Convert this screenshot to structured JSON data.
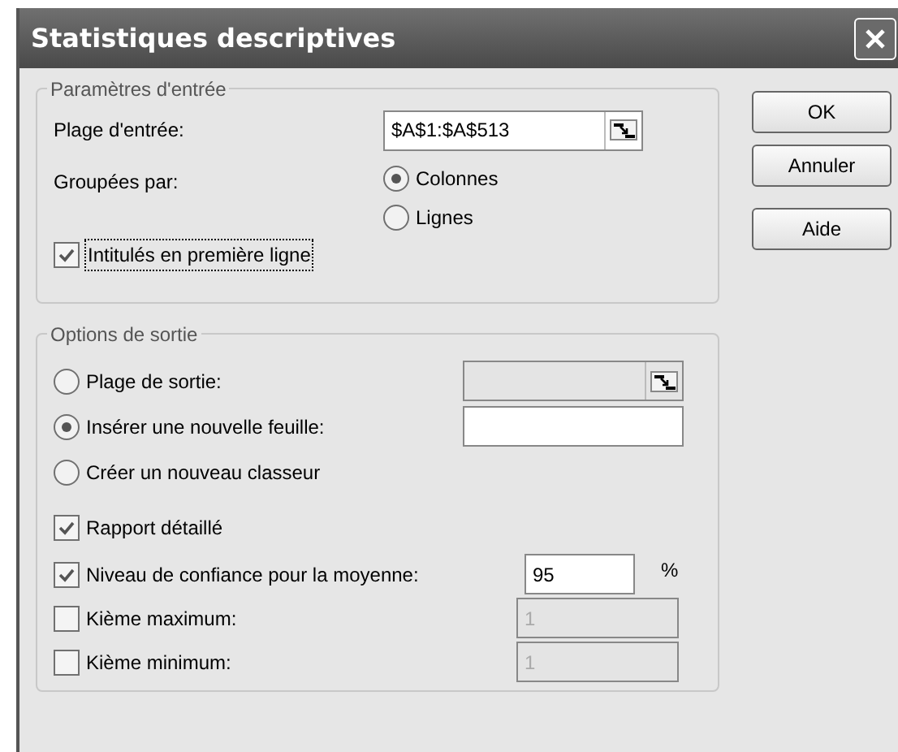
{
  "window": {
    "title": "Statistiques descriptives"
  },
  "input_group": {
    "legend": "Paramètres d'entrée",
    "range": {
      "label": "Plage d'entrée:",
      "value": "$A$1:$A$513"
    },
    "grouped_by": {
      "label": "Groupées par:",
      "options": [
        {
          "label": "Colonnes",
          "selected": true
        },
        {
          "label": "Lignes",
          "selected": false
        }
      ]
    },
    "headers_checkbox": {
      "label": "Intitulés en première ligne",
      "checked": true,
      "focused": true
    }
  },
  "output_group": {
    "legend": "Options de sortie",
    "destinations": [
      {
        "label": "Plage de sortie:",
        "selected": false,
        "kind": "range",
        "disabled": true
      },
      {
        "label": "Insérer une nouvelle feuille:",
        "selected": true,
        "kind": "text",
        "disabled": false
      },
      {
        "label": "Créer un nouveau classeur",
        "selected": false,
        "kind": "none"
      }
    ],
    "options": [
      {
        "label": "Rapport détaillé",
        "checked": true,
        "kind": "plain"
      },
      {
        "label": "Niveau de confiance pour la moyenne:",
        "checked": true,
        "kind": "percent",
        "value": "95",
        "unit": "%",
        "disabled": false
      },
      {
        "label": "Kième maximum:",
        "checked": false,
        "kind": "number",
        "value": "1",
        "disabled": true
      },
      {
        "label": "Kième minimum:",
        "checked": false,
        "kind": "number",
        "value": "1",
        "disabled": true
      }
    ]
  },
  "buttons": [
    {
      "label": "OK"
    },
    {
      "label": "Annuler"
    },
    {
      "label": "Aide"
    }
  ]
}
